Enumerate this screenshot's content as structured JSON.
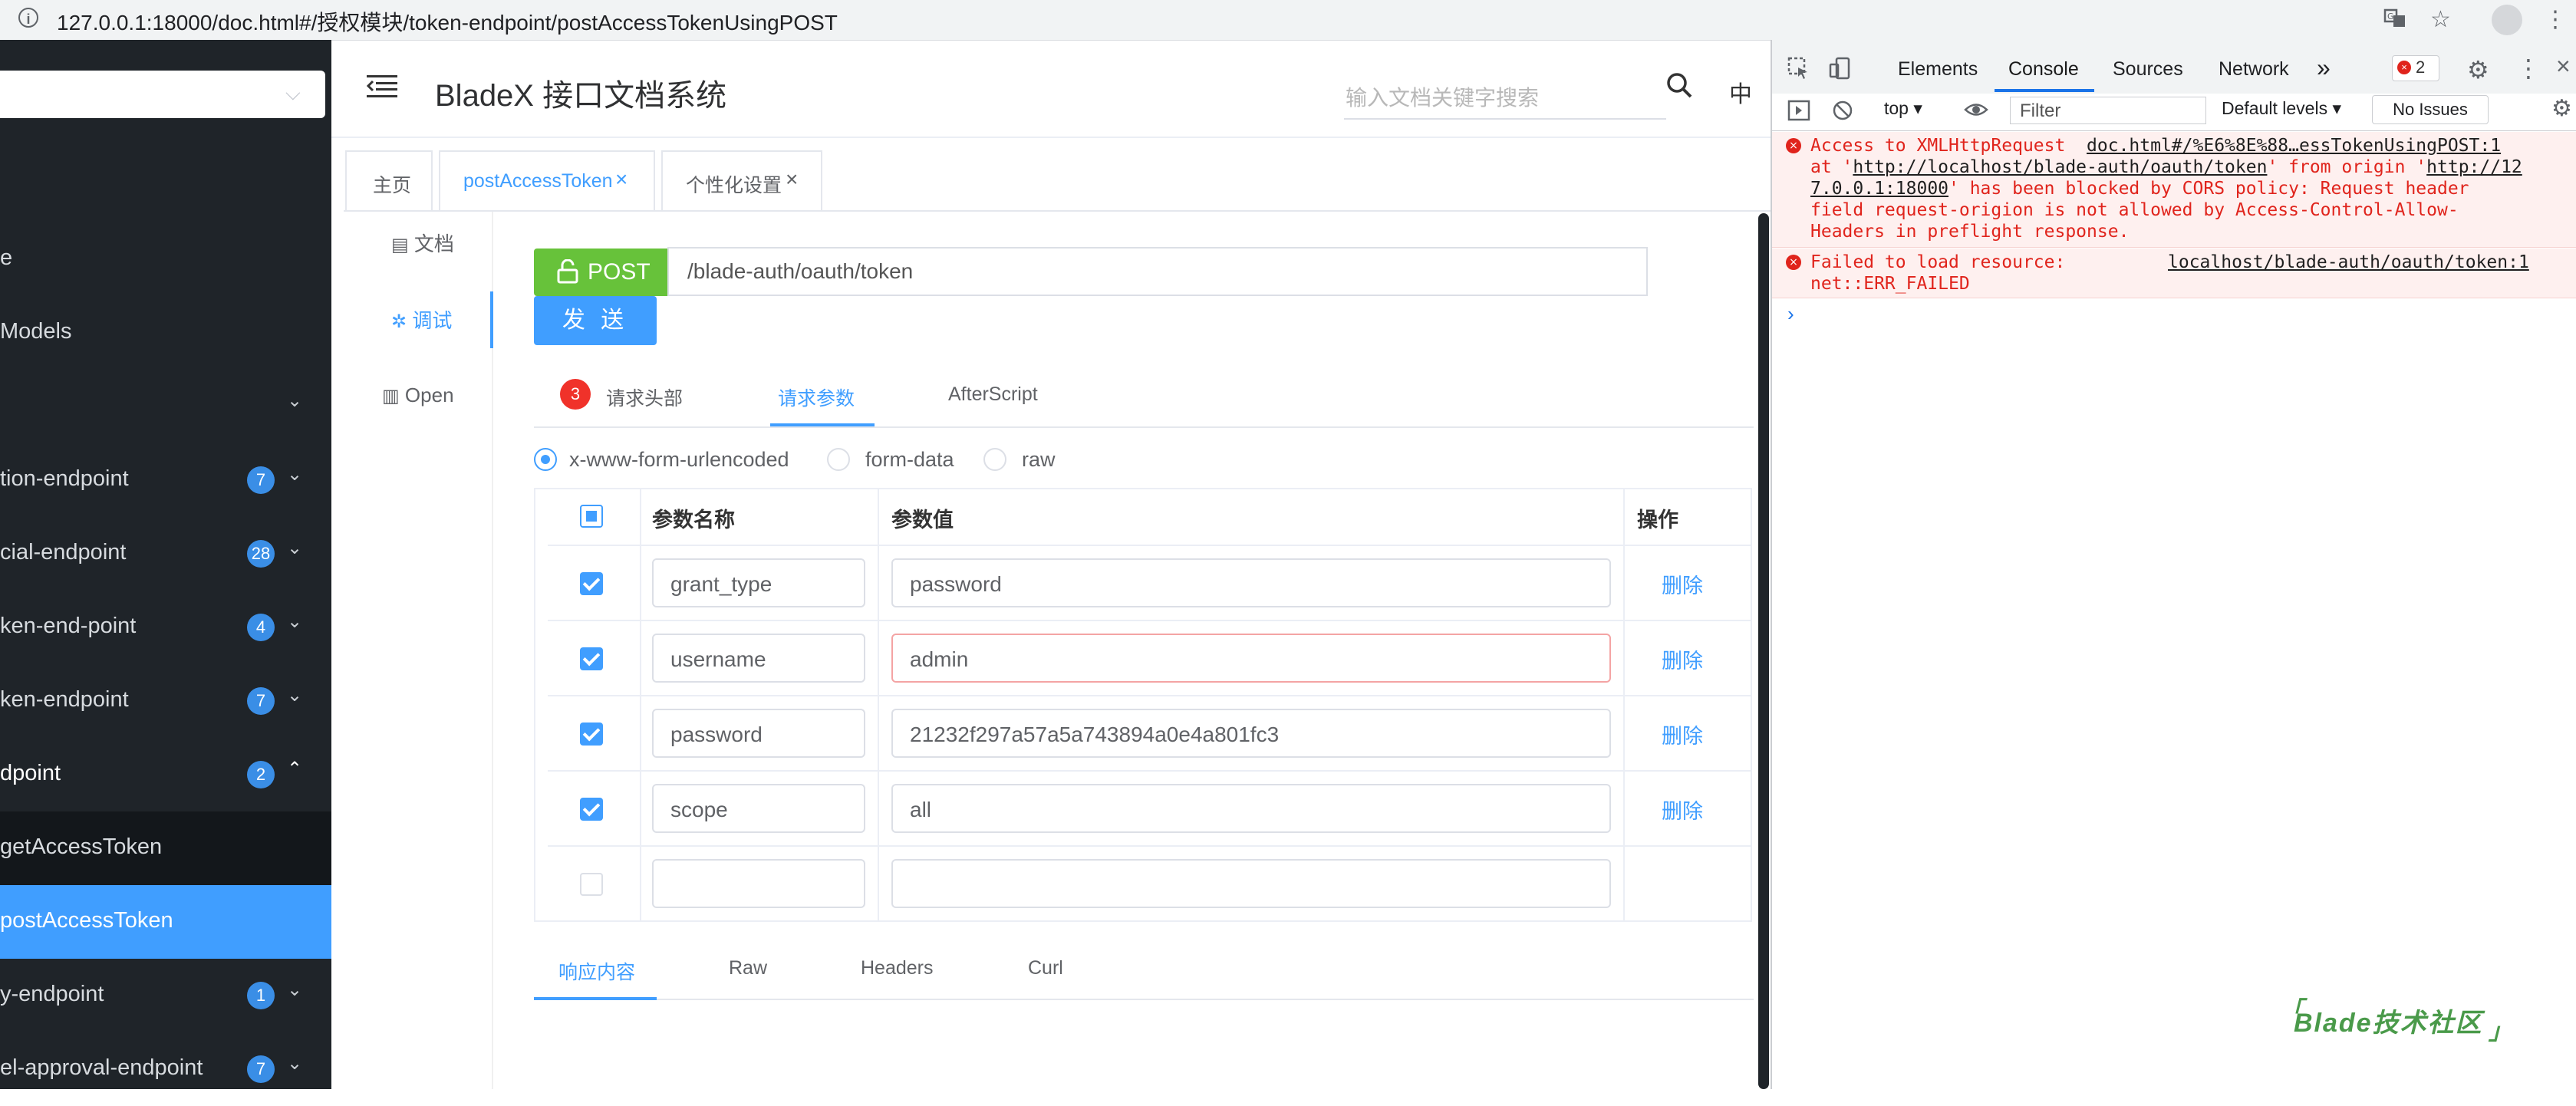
{
  "browser": {
    "url_host": "127.0.0.1",
    "url_rest": ":18000/doc.html#/授权模块/token-endpoint/postAccessTokenUsingPOST"
  },
  "sidebar": {
    "items": [
      {
        "label": "e"
      },
      {
        "label": " Models"
      },
      {
        "label": ""
      },
      {
        "label": "tion-endpoint",
        "badge": "7"
      },
      {
        "label": "cial-endpoint",
        "badge": "28"
      },
      {
        "label": "ken-end-point",
        "badge": "4"
      },
      {
        "label": "ken-endpoint",
        "badge": "7"
      },
      {
        "label": "dpoint",
        "badge": "2"
      },
      {
        "label": "getAccessToken"
      },
      {
        "label": "postAccessToken"
      },
      {
        "label": "y-endpoint",
        "badge": "1"
      },
      {
        "label": "el-approval-endpoint",
        "badge": "7"
      }
    ]
  },
  "header": {
    "title": "BladeX 接口文档系统",
    "search_placeholder": "输入文档关键字搜索",
    "lang": "中"
  },
  "tabs": [
    {
      "label": "主页"
    },
    {
      "label": "postAccessToken"
    },
    {
      "label": "个性化设置"
    }
  ],
  "side_nav": [
    {
      "label": "文档"
    },
    {
      "label": "调试"
    },
    {
      "label": "Open"
    }
  ],
  "request": {
    "method": "POST",
    "path": "/blade-auth/oauth/token",
    "send_label": "发 送"
  },
  "subtabs": {
    "headers_count": "3",
    "headers": "请求头部",
    "params": "请求参数",
    "afterscript": "AfterScript"
  },
  "content_types": [
    {
      "label": "x-www-form-urlencoded",
      "selected": true
    },
    {
      "label": "form-data",
      "selected": false
    },
    {
      "label": "raw",
      "selected": false
    }
  ],
  "table": {
    "headers": [
      "参数名称",
      "参数值",
      "操作"
    ],
    "rows": [
      {
        "checked": true,
        "name": "grant_type",
        "value": "password",
        "action": "删除"
      },
      {
        "checked": true,
        "name": "username",
        "value": "admin",
        "action": "删除"
      },
      {
        "checked": true,
        "name": "password",
        "value": "21232f297a57a5a743894a0e4a801fc3",
        "action": "删除"
      },
      {
        "checked": true,
        "name": "scope",
        "value": "all",
        "action": "删除"
      },
      {
        "checked": false,
        "name": "",
        "value": "",
        "action": ""
      }
    ]
  },
  "response_tabs": [
    "响应内容",
    "Raw",
    "Headers",
    "Curl"
  ],
  "devtools": {
    "tabs": [
      "Elements",
      "Console",
      "Sources",
      "Network"
    ],
    "more": "»",
    "error_count": "2",
    "context": "top",
    "filter_placeholder": "Filter",
    "levels": "Default levels",
    "no_issues": "No Issues",
    "messages": [
      {
        "l1a": "Access to XMLHttpRequest  ",
        "l1b": "doc.html#/%E6%8E%88…essTokenUsingPOST:1",
        "l2a": "at '",
        "l2b": "http://localhost/blade-auth/oauth/token",
        "l2c": "' from origin '",
        "l2d": "http://12",
        "l3a": "7.0.0.1:18000",
        "l3b": "' has been blocked by CORS policy: Request header",
        "l4": "field request-origion is not allowed by Access-Control-Allow-",
        "l5": "Headers in preflight response."
      },
      {
        "l1a": "Failed to load resource:",
        "l1b": "localhost/blade-auth/oauth/token:1",
        "l2a": "net::ERR_FAILED"
      }
    ],
    "prompt": "›"
  },
  "watermark": "Blade技术社区",
  "colors": {
    "accent": "#409eff",
    "post": "#67c23a",
    "sidebar": "#1f2429",
    "error": "#e0241c"
  }
}
